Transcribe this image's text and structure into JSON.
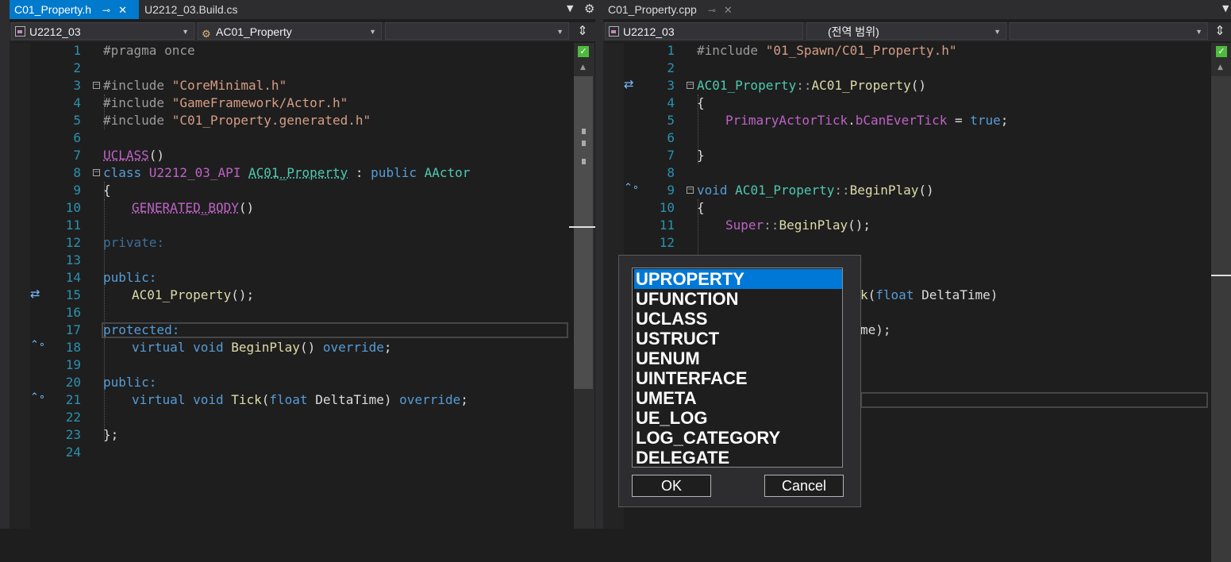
{
  "left_pane": {
    "tabs": [
      {
        "label": "C01_Property.h",
        "active": true
      },
      {
        "label": "U2212_03.Build.cs",
        "active": false
      }
    ],
    "project_combo": "U2212_03",
    "class_combo": "AC01_Property",
    "member_combo": "",
    "line_numbers": [
      "1",
      "2",
      "3",
      "4",
      "5",
      "6",
      "7",
      "8",
      "9",
      "10",
      "11",
      "12",
      "13",
      "14",
      "15",
      "16",
      "17",
      "18",
      "19",
      "20",
      "21",
      "22",
      "23",
      "24"
    ]
  },
  "right_pane": {
    "tabs": [
      {
        "label": "C01_Property.cpp",
        "active": false
      }
    ],
    "project_combo": "U2212_03",
    "scope_combo": "(전역 범위)",
    "member_combo": "",
    "line_numbers": [
      "1",
      "2",
      "3",
      "4",
      "5",
      "6",
      "7",
      "8",
      "9",
      "10",
      "11",
      "12"
    ]
  },
  "icons": {
    "pin": "pin-icon",
    "close": "close-icon",
    "gear": "gear-icon",
    "split": "split-icon",
    "check": "check-icon"
  },
  "code_left": {
    "l1": "#pragma once",
    "l3_a": "#include ",
    "l3_b": "\"CoreMinimal.h\"",
    "l4_a": "#include ",
    "l4_b": "\"GameFramework/Actor.h\"",
    "l5_a": "#include ",
    "l5_b": "\"C01_Property.generated.h\"",
    "l7_a": "UCLASS",
    "l7_b": "()",
    "l8_a": "class ",
    "l8_b": "U2212_03_API",
    "l8_c": " ",
    "l8_d": "AC01_Property",
    "l8_e": " : ",
    "l8_f": "public",
    "l8_g": " AActor",
    "l9": "{",
    "l10_a": "GENERATED_BODY",
    "l10_b": "()",
    "l12": "private:",
    "l14": "public:",
    "l15_a": "AC01_Property",
    "l15_b": "();",
    "l17": "protected:",
    "l18_a": "virtual void ",
    "l18_b": "BeginPlay",
    "l18_c": "() ",
    "l18_d": "override",
    "l18_e": ";",
    "l20": "public:",
    "l21_a": "virtual void ",
    "l21_b": "Tick",
    "l21_c": "(",
    "l21_d": "float",
    "l21_e": " DeltaTime) ",
    "l21_f": "override",
    "l21_g": ";",
    "l23": "};"
  },
  "code_right": {
    "l1_a": "#include ",
    "l1_b": "\"01_Spawn/C01_Property.h\"",
    "l3_a": "AC01_Property",
    "l3_b": "::",
    "l3_c": "AC01_Property",
    "l3_d": "()",
    "l4": "{",
    "l5_a": "PrimaryActorTick",
    "l5_b": ".",
    "l5_c": "bCanEverTick",
    "l5_d": " = ",
    "l5_e": "true",
    "l5_f": ";",
    "l7": "}",
    "l9_a": "void ",
    "l9_b": "AC01_Property",
    "l9_c": "::",
    "l9_d": "BeginPlay",
    "l9_e": "()",
    "l10": "{",
    "l11_a": "Super",
    "l11_b": "::",
    "l11_c": "BeginPlay",
    "l11_d": "();",
    "l15_a": "k",
    "l15_b": "(",
    "l15_c": "float",
    "l15_d": " DeltaTime)",
    "l17": "me);"
  },
  "dialog": {
    "items": [
      "UPROPERTY",
      "UFUNCTION",
      "UCLASS",
      "USTRUCT",
      "UENUM",
      "UINTERFACE",
      "UMETA",
      "UE_LOG",
      "LOG_CATEGORY",
      "DELEGATE"
    ],
    "selected_index": 0,
    "ok_label": "OK",
    "cancel_label": "Cancel"
  }
}
